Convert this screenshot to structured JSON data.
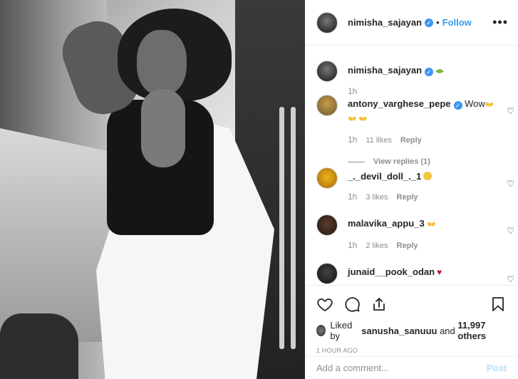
{
  "post": {
    "author": "nimisha_sajayan",
    "follow_label": "Follow",
    "dot": "•",
    "more": "•••"
  },
  "caption": {
    "author": "nimisha_sajayan",
    "time": "1h"
  },
  "comments": [
    {
      "user": "antony_varghese_pepe",
      "text": "Wow",
      "emoji_line": "👐 👐",
      "time": "1h",
      "likes": "11 likes",
      "reply": "Reply",
      "view_replies": "View replies (1)"
    },
    {
      "user": "_._devil_doll_._1",
      "text": "",
      "time": "1h",
      "likes": "3 likes",
      "reply": "Reply"
    },
    {
      "user": "malavika_appu_3",
      "text": "",
      "time": "1h",
      "likes": "2 likes",
      "reply": "Reply"
    },
    {
      "user": "junaid__pook_odan",
      "text": ""
    }
  ],
  "likes_summary": {
    "prefix": "Liked by ",
    "user": "sanusha_sanuuu",
    "middle": " and ",
    "count": "11,997 others"
  },
  "timestamp": "1 HOUR AGO",
  "add_comment": {
    "placeholder": "Add a comment...",
    "post_label": "Post"
  },
  "icons": [
    "heart-icon",
    "comment-icon",
    "share-icon",
    "bookmark-icon",
    "verified-icon",
    "more-icon"
  ],
  "colors": {
    "link": "#3897f0",
    "post_disabled": "#b2dffc",
    "muted": "#8e8e8e"
  }
}
